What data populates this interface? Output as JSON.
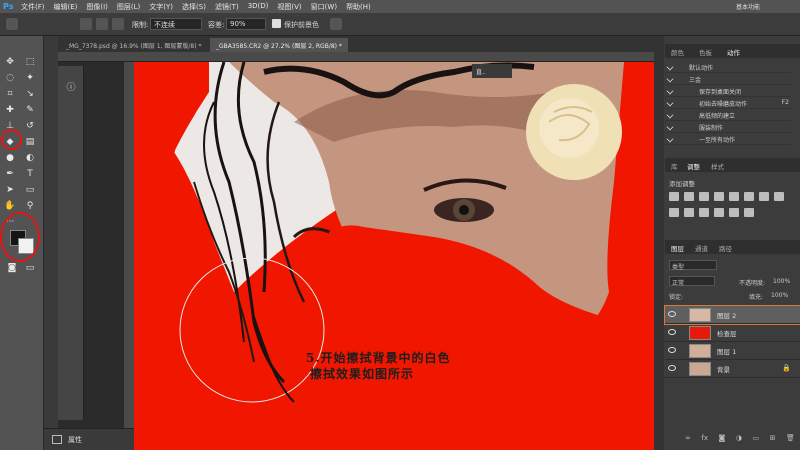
{
  "app": {
    "logo": "Ps",
    "menu": [
      "文件(F)",
      "编辑(E)",
      "图像(I)",
      "图层(L)",
      "文字(Y)",
      "选择(S)",
      "滤镜(T)",
      "3D(D)",
      "视图(V)",
      "窗口(W)",
      "帮助(H)"
    ],
    "workspace_label": "基本功能"
  },
  "options_bar": {
    "mode_label": "限制:",
    "mode_value": "不连续",
    "tolerance_label": "容差:",
    "tolerance_value": "90%",
    "protect_label": "保护前景色"
  },
  "doc_tabs": [
    {
      "label": "_MG_7378.psd @ 16.9% (图层 1, 图层蒙版/8) *",
      "active": false
    },
    {
      "label": "_GBA3585.CR2 @ 27.2% (图层 2, RGB/8) *",
      "active": true
    }
  ],
  "annotation": {
    "line1": "5.开始擦拭背景中的白色",
    "line2": "擦拭效果如图所示"
  },
  "properties_panel": {
    "label": "属性"
  },
  "float_label": "直..",
  "actions_panel": {
    "tabs": [
      "颜色",
      "色板",
      "动作"
    ],
    "active_tab": "动作",
    "items": [
      {
        "label": "默认动作",
        "shortcut": ""
      },
      {
        "label": "三金",
        "shortcut": ""
      },
      {
        "label": "保存到桌面关闭",
        "shortcut": ""
      },
      {
        "label": "初始去噪磨皮动作",
        "shortcut": "F2"
      },
      {
        "label": "高低频的建立",
        "shortcut": ""
      },
      {
        "label": "服装制作",
        "shortcut": ""
      },
      {
        "label": "一至所有动作",
        "shortcut": ""
      }
    ]
  },
  "adjust_panel": {
    "tabs": [
      "库",
      "调整",
      "样式"
    ],
    "active_tab": "调整",
    "title": "添加调整"
  },
  "layers_panel": {
    "tabs": [
      "图层",
      "通道",
      "路径"
    ],
    "active_tab": "图层",
    "filter_label": "类型",
    "blend_mode": "正常",
    "opacity_label": "不透明度:",
    "opacity_value": "100%",
    "lock_label": "锁定:",
    "fill_label": "填充:",
    "fill_value": "100%",
    "layers": [
      {
        "name": "图层 2",
        "selected": true,
        "thumb": "#d8b8a4"
      },
      {
        "name": "检查层",
        "selected": false,
        "thumb": "#e51a0a"
      },
      {
        "name": "图层 1",
        "selected": false,
        "thumb": "#cfae9a"
      },
      {
        "name": "背景",
        "selected": false,
        "thumb": "#c9a995",
        "locked": true
      }
    ]
  },
  "colors": {
    "canvas_red": "#f11600",
    "highlight": "#e21414"
  }
}
